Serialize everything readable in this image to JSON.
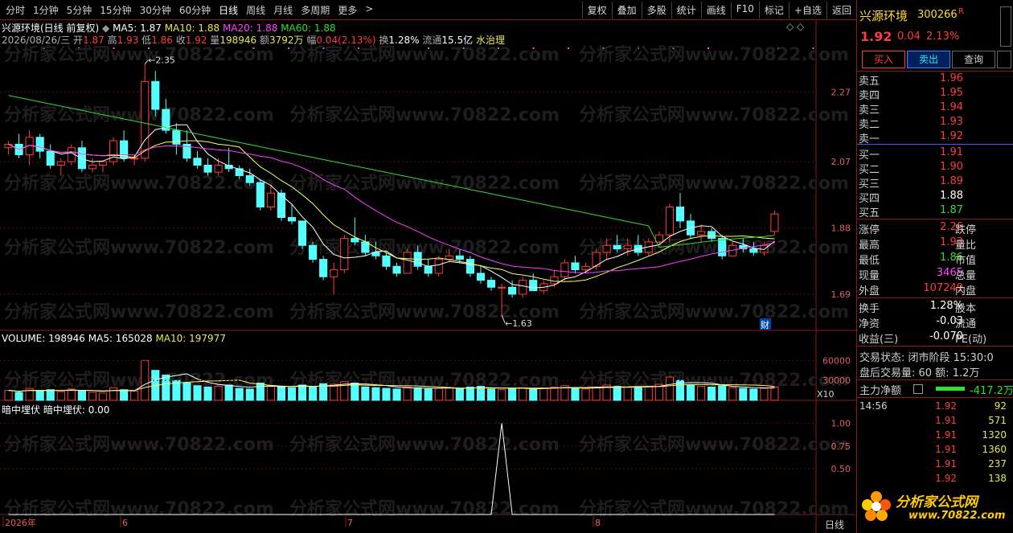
{
  "toolbar": {
    "periods": [
      "分时",
      "1分钟",
      "5分钟",
      "15分钟",
      "30分钟",
      "60分钟",
      "日线",
      "周线",
      "月线",
      "多周期",
      "更多"
    ],
    "more_arrow": ">",
    "tools": [
      "复权",
      "叠加",
      "多股",
      "统计",
      "画线",
      "F10",
      "标记",
      "+自选",
      "返回"
    ]
  },
  "header": {
    "stock_title": "兴源环境(日线 前复权)",
    "ma5": "MA5: 1.87",
    "ma10": "MA10: 1.88",
    "ma20": "MA20: 1.88",
    "ma60": "MA60: 1.88",
    "date": "2026/08/26/三",
    "open_l": "开",
    "open": "1.87",
    "high_l": "高",
    "high": "1.93",
    "low_l": "低",
    "low": "1.86",
    "close_l": "收",
    "close": "1.92",
    "vol_l": "量",
    "vol": "198946",
    "amt_l": "额",
    "amt": "3792万",
    "chg_l": "幅",
    "chg": "0.04(2.13%)",
    "turn_l": "换",
    "turn": "1.28%",
    "float_l": "流通",
    "float": "15.5亿",
    "industry": "水治理",
    "corner_icons": "◇ ◇"
  },
  "price_chart": {
    "y_ticks": [
      "2.27",
      "2.07",
      "1.88",
      "1.69"
    ],
    "high_mark": "2.35",
    "low_mark": "1.63",
    "fin_badge": "财",
    "colors": {
      "up": "#ff3c3c",
      "down": "#54ffff",
      "ma5": "#ffffff",
      "ma10": "#ffff66",
      "ma20": "#ff40ff",
      "ma60": "#33dd33"
    }
  },
  "volume_chart": {
    "label": "VOLUME: 198946",
    "ma5": "MA5: 165028",
    "ma10": "MA10: 197977",
    "y_ticks": [
      "60000",
      "30000"
    ],
    "unit": "X10"
  },
  "indicator": {
    "name": "暗中埋伏",
    "value_label": "暗中埋伏: 0.00",
    "y_ticks": [
      "1.00",
      "0.75",
      "0.50"
    ]
  },
  "x_axis": {
    "labels": [
      "2026年",
      "6",
      "7",
      "8"
    ],
    "period": "日线"
  },
  "panel": {
    "name": "兴源环境",
    "code": "300266",
    "flag": "R",
    "price": "1.92",
    "change": "0.04",
    "pct": "2.13%",
    "buttons": [
      "买入",
      "卖出",
      "查询"
    ],
    "asks": [
      [
        "卖五",
        "1.96"
      ],
      [
        "卖四",
        "1.95"
      ],
      [
        "卖三",
        "1.94"
      ],
      [
        "卖二",
        "1.93"
      ],
      [
        "卖一",
        "1.92"
      ]
    ],
    "bids": [
      [
        "买一",
        "1.91"
      ],
      [
        "买二",
        "1.90"
      ],
      [
        "买三",
        "1.89"
      ],
      [
        "买四",
        "1.88"
      ],
      [
        "买五",
        "1.87"
      ]
    ],
    "stats": [
      [
        "涨停",
        "2.26",
        "跌停",
        ""
      ],
      [
        "最高",
        "1.93",
        "量比",
        ""
      ],
      [
        "最低",
        "1.86",
        "市值",
        ""
      ],
      [
        "现量",
        "3465",
        "总量",
        ""
      ],
      [
        "外盘",
        "107249",
        "内盘",
        ""
      ]
    ],
    "stats2": [
      [
        "换手",
        "1.28%",
        "股本"
      ],
      [
        "净资",
        "-0.03",
        "流通"
      ],
      [
        "收益(三)",
        "-0.070",
        "PE(动)"
      ]
    ],
    "trade_status": "交易状态: 闭市阶段 15:30:0",
    "after_hours": "盘后交易量: 60  额: 1.2万",
    "main_flow_l": "主力净额",
    "main_flow": "-417.2万",
    "ticks_time": "14:56",
    "ticks": [
      [
        "1.92",
        "92"
      ],
      [
        "1.91",
        "571"
      ],
      [
        "1.91",
        "1320"
      ],
      [
        "1.91",
        "1360"
      ],
      [
        "1.91",
        "237"
      ],
      [
        "1.92",
        "138"
      ]
    ],
    "logo_title": "分析家公式网",
    "logo_url": "www.70822.com"
  },
  "watermark": "分析家公式网www.70822.com",
  "chart_data": {
    "type": "candlestick",
    "note_ma": [
      "MA5",
      "MA10",
      "MA20",
      "MA60"
    ],
    "ohlc": [
      [
        2.11,
        2.13,
        2.09,
        2.12
      ],
      [
        2.12,
        2.15,
        2.08,
        2.09
      ],
      [
        2.09,
        2.16,
        2.06,
        2.14
      ],
      [
        2.14,
        2.15,
        2.08,
        2.1
      ],
      [
        2.1,
        2.12,
        2.05,
        2.06
      ],
      [
        2.06,
        2.08,
        2.03,
        2.07
      ],
      [
        2.07,
        2.12,
        2.06,
        2.11
      ],
      [
        2.11,
        2.13,
        2.04,
        2.05
      ],
      [
        2.05,
        2.08,
        2.04,
        2.06
      ],
      [
        2.06,
        2.07,
        2.04,
        2.07
      ],
      [
        2.07,
        2.14,
        2.06,
        2.13
      ],
      [
        2.13,
        2.16,
        2.07,
        2.08
      ],
      [
        2.08,
        2.09,
        2.06,
        2.08
      ],
      [
        2.08,
        2.35,
        2.07,
        2.3
      ],
      [
        2.3,
        2.33,
        2.2,
        2.22
      ],
      [
        2.22,
        2.25,
        2.15,
        2.16
      ],
      [
        2.16,
        2.18,
        2.09,
        2.12
      ],
      [
        2.12,
        2.16,
        2.07,
        2.08
      ],
      [
        2.08,
        2.1,
        2.05,
        2.06
      ],
      [
        2.06,
        2.08,
        2.03,
        2.04
      ],
      [
        2.04,
        2.08,
        2.03,
        2.06
      ],
      [
        2.06,
        2.11,
        2.04,
        2.05
      ],
      [
        2.05,
        2.06,
        2.02,
        2.03
      ],
      [
        2.03,
        2.05,
        2.0,
        2.01
      ],
      [
        2.01,
        2.02,
        1.93,
        1.94
      ],
      [
        1.94,
        2.0,
        1.93,
        1.98
      ],
      [
        1.98,
        1.99,
        1.9,
        1.91
      ],
      [
        1.91,
        1.95,
        1.89,
        1.9
      ],
      [
        1.9,
        1.9,
        1.82,
        1.83
      ],
      [
        1.83,
        1.84,
        1.78,
        1.79
      ],
      [
        1.79,
        1.8,
        1.73,
        1.74
      ],
      [
        1.74,
        1.78,
        1.69,
        1.76
      ],
      [
        1.76,
        1.86,
        1.75,
        1.85
      ],
      [
        1.85,
        1.91,
        1.83,
        1.84
      ],
      [
        1.84,
        1.86,
        1.8,
        1.81
      ],
      [
        1.81,
        1.84,
        1.79,
        1.8
      ],
      [
        1.8,
        1.81,
        1.76,
        1.77
      ],
      [
        1.77,
        1.78,
        1.74,
        1.75
      ],
      [
        1.75,
        1.82,
        1.75,
        1.81
      ],
      [
        1.81,
        1.83,
        1.76,
        1.77
      ],
      [
        1.77,
        1.79,
        1.74,
        1.75
      ],
      [
        1.75,
        1.8,
        1.74,
        1.79
      ],
      [
        1.79,
        1.82,
        1.78,
        1.8
      ],
      [
        1.8,
        1.82,
        1.78,
        1.79
      ],
      [
        1.79,
        1.8,
        1.74,
        1.75
      ],
      [
        1.75,
        1.77,
        1.72,
        1.73
      ],
      [
        1.73,
        1.74,
        1.7,
        1.71
      ],
      [
        1.71,
        1.72,
        1.63,
        1.71
      ],
      [
        1.71,
        1.73,
        1.68,
        1.69
      ],
      [
        1.69,
        1.74,
        1.68,
        1.73
      ],
      [
        1.73,
        1.75,
        1.7,
        1.7
      ],
      [
        1.7,
        1.73,
        1.69,
        1.72
      ],
      [
        1.72,
        1.76,
        1.71,
        1.74
      ],
      [
        1.74,
        1.79,
        1.73,
        1.78
      ],
      [
        1.78,
        1.8,
        1.75,
        1.76
      ],
      [
        1.76,
        1.78,
        1.75,
        1.77
      ],
      [
        1.77,
        1.82,
        1.76,
        1.81
      ],
      [
        1.81,
        1.85,
        1.79,
        1.83
      ],
      [
        1.83,
        1.86,
        1.81,
        1.82
      ],
      [
        1.82,
        1.85,
        1.8,
        1.83
      ],
      [
        1.83,
        1.86,
        1.8,
        1.81
      ],
      [
        1.81,
        1.85,
        1.8,
        1.84
      ],
      [
        1.84,
        1.87,
        1.83,
        1.86
      ],
      [
        1.86,
        1.95,
        1.84,
        1.94
      ],
      [
        1.94,
        1.98,
        1.88,
        1.9
      ],
      [
        1.9,
        1.92,
        1.85,
        1.86
      ],
      [
        1.86,
        1.89,
        1.84,
        1.87
      ],
      [
        1.87,
        1.88,
        1.84,
        1.85
      ],
      [
        1.85,
        1.86,
        1.79,
        1.8
      ],
      [
        1.8,
        1.84,
        1.8,
        1.83
      ],
      [
        1.83,
        1.85,
        1.81,
        1.82
      ],
      [
        1.82,
        1.84,
        1.8,
        1.81
      ],
      [
        1.81,
        1.84,
        1.8,
        1.83
      ],
      [
        1.87,
        1.93,
        1.86,
        1.92
      ]
    ],
    "volume": [
      150,
      120,
      180,
      140,
      160,
      130,
      170,
      150,
      120,
      110,
      190,
      160,
      140,
      600,
      450,
      380,
      300,
      260,
      220,
      200,
      210,
      230,
      180,
      170,
      260,
      220,
      200,
      190,
      230,
      210,
      250,
      240,
      280,
      260,
      200,
      190,
      180,
      170,
      200,
      190,
      170,
      180,
      190,
      180,
      200,
      210,
      170,
      160,
      180,
      190,
      170,
      180,
      200,
      220,
      190,
      170,
      200,
      230,
      210,
      200,
      190,
      210,
      240,
      350,
      300,
      230,
      210,
      200,
      220,
      190,
      180,
      170,
      180,
      199
    ],
    "indicator": [
      0,
      0,
      0,
      0,
      0,
      0,
      0,
      0,
      0,
      0,
      0,
      0,
      0,
      0,
      0,
      0,
      0,
      0,
      0,
      0,
      0,
      0,
      0,
      0,
      0,
      0,
      0,
      0,
      0,
      0,
      0,
      0,
      0,
      0,
      0,
      0,
      0,
      0,
      0,
      0,
      0,
      0,
      0,
      0,
      0,
      0,
      0,
      1,
      0,
      0,
      0,
      0,
      0,
      0,
      0,
      0,
      0,
      0,
      0,
      0,
      0,
      0,
      0,
      0,
      0,
      0,
      0,
      0,
      0,
      0,
      0,
      0,
      0,
      0
    ],
    "price_range": [
      1.6,
      2.4
    ],
    "volume_range": [
      0,
      700
    ],
    "indicator_range": [
      0,
      1.1
    ]
  }
}
